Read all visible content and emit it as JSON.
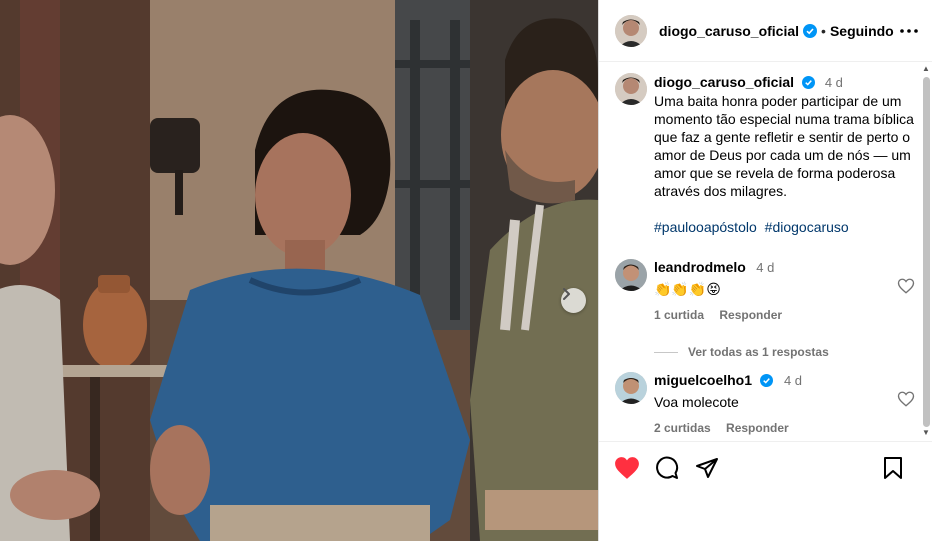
{
  "header": {
    "username": "diogo_caruso_oficial",
    "dot": "•",
    "follow_status": "Seguindo",
    "more_icon": "more-horizontal-icon"
  },
  "caption": {
    "username": "diogo_caruso_oficial",
    "time": "4 d",
    "text": "Uma baita honra poder participar de um momento tão especial numa trama bíblica que faz a gente refletir e sentir de perto o amor de Deus por cada um de nós — um amor que se revela de forma poderosa através dos milagres.",
    "hashtags": [
      "#paulooapóstolo",
      "#diogocaruso"
    ]
  },
  "comments": [
    {
      "username": "leandrodmelo",
      "time": "4 d",
      "text": "👏👏👏😝",
      "likes": "1 curtida",
      "reply_label": "Responder",
      "verified": false
    },
    {
      "username": "miguelcoelho1",
      "time": "4 d",
      "text": "Voa molecote",
      "likes": "2 curtidas",
      "reply_label": "Responder",
      "verified": true
    }
  ],
  "view_replies": "Ver todas as 1 respostas",
  "actions": {
    "liked": true,
    "like_color": "#ff3040",
    "icons": [
      "heart-icon",
      "comment-icon",
      "share-icon",
      "bookmark-icon"
    ]
  },
  "colors": {
    "verified_blue": "#0095f6",
    "hashtag": "#00376b",
    "muted": "#737373"
  }
}
